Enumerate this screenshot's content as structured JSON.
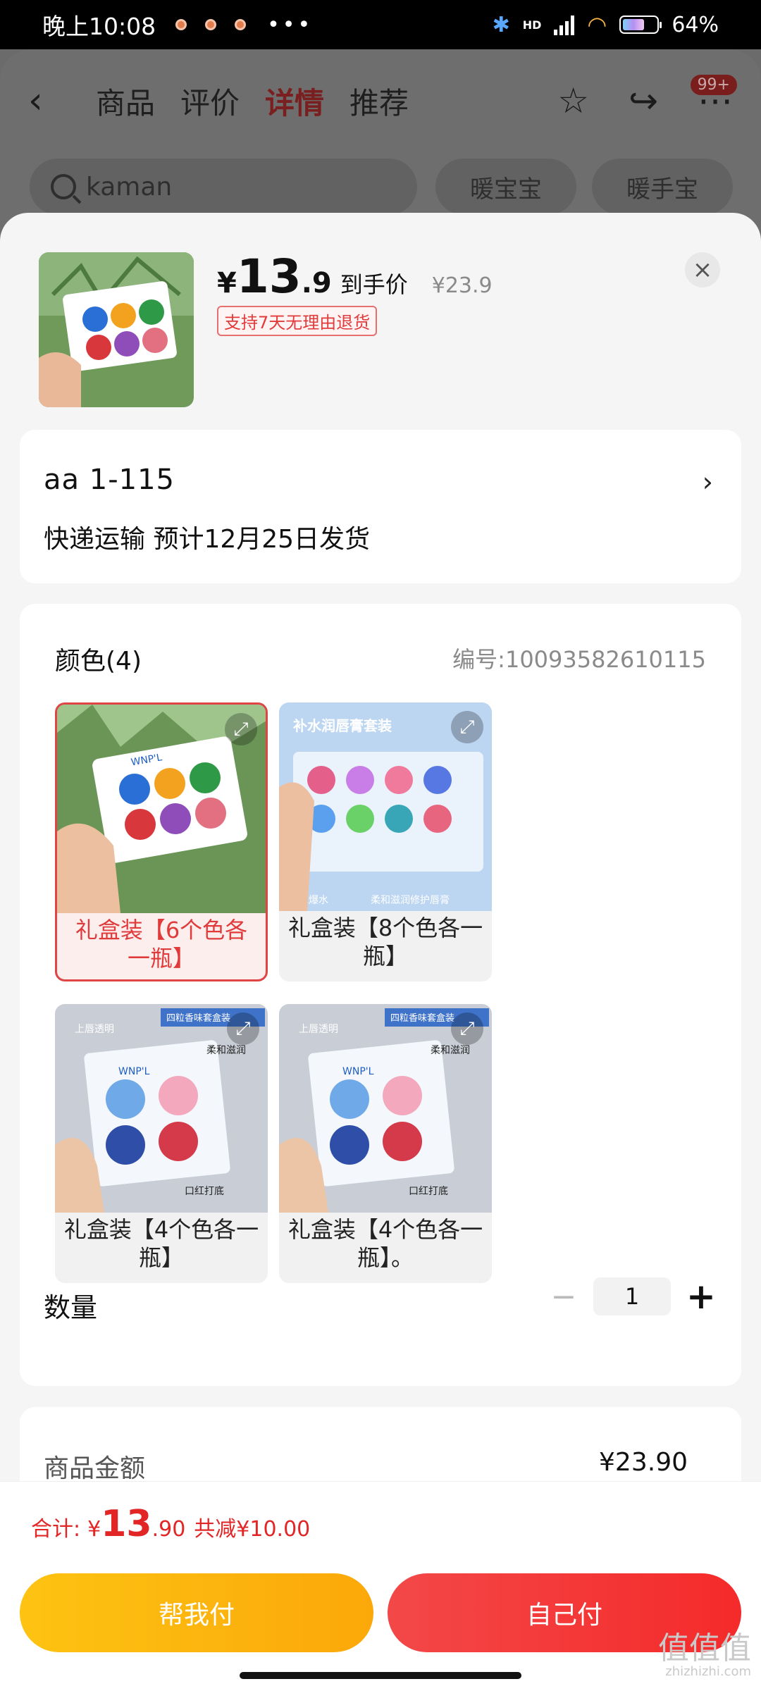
{
  "status_bar": {
    "time": "晚上10:08",
    "more": "•••",
    "network": "HD",
    "battery": "64%"
  },
  "nav": {
    "back": "‹",
    "tabs": [
      {
        "label": "商品",
        "active": false
      },
      {
        "label": "评价",
        "active": false
      },
      {
        "label": "详情",
        "active": true
      },
      {
        "label": "推荐",
        "active": false
      }
    ],
    "badge": "99+"
  },
  "search": {
    "query": "kaman",
    "chips": [
      "暖宝宝",
      "暖手宝"
    ]
  },
  "product": {
    "price_yen": "¥",
    "price_int": "13",
    "price_dec": ".9",
    "price_label": "到手价",
    "original_price": "¥23.9",
    "return_tag": "支持7天无理由退货",
    "close": "×"
  },
  "address": {
    "line1": "aa  1-115",
    "line2": "快递运输 预计12月25日发货"
  },
  "spec": {
    "title": "颜色(4)",
    "sku": "编号:10093582610115",
    "options": [
      {
        "label": "礼盒装【6个色各一瓶】",
        "selected": true,
        "img_text": "WNP'L"
      },
      {
        "label": "礼盒装【8个色各一瓶】",
        "selected": false,
        "img_text": "补水润唇膏套装",
        "img_text2": "一抹爆水",
        "img_text3": "柔和滋润修护唇膏"
      },
      {
        "label": "礼盒装【4个色各一瓶】",
        "selected": false,
        "img_text": "四粒香味套盒装",
        "img_text2": "上唇透明",
        "img_text3": "柔和滋润",
        "img_text4": "口红打底",
        "img_text5": "WNP'L"
      },
      {
        "label": "礼盒装【4个色各一瓶】。",
        "selected": false,
        "img_text": "四粒香味套盒装",
        "img_text2": "上唇透明",
        "img_text3": "柔和滋润",
        "img_text4": "口红打底",
        "img_text5": "WNP'L"
      }
    ],
    "quantity_label": "数量",
    "quantity": "1",
    "minus": "−",
    "plus": "+"
  },
  "amount": {
    "label": "商品金额",
    "value": "¥23.90"
  },
  "footer": {
    "total_label": "合计:",
    "total_yen": "¥",
    "total_int": "13",
    "total_dec": ".90",
    "saved": "共减¥10.00",
    "help_pay": "帮我付",
    "self_pay": "自己付"
  },
  "watermark": {
    "main": "值值值",
    "sub": "zhizhizhi.com"
  },
  "colors": {
    "accent_red": "#e22626",
    "help_yellow": "#fdb80e",
    "self_red": "#f33a3a",
    "selected_border": "#e04545"
  }
}
